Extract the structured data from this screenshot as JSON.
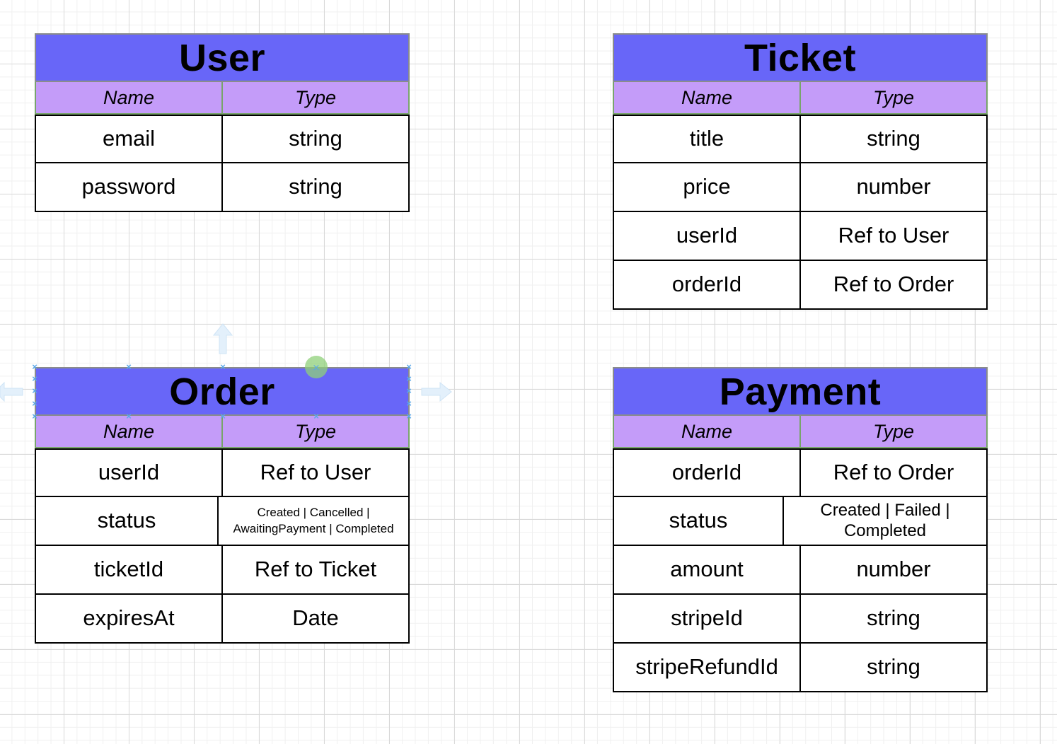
{
  "entities": {
    "user": {
      "title": "User",
      "header": {
        "name": "Name",
        "type": "Type"
      },
      "rows": [
        {
          "name": "email",
          "type": "string"
        },
        {
          "name": "password",
          "type": "string"
        }
      ]
    },
    "ticket": {
      "title": "Ticket",
      "header": {
        "name": "Name",
        "type": "Type"
      },
      "rows": [
        {
          "name": "title",
          "type": "string"
        },
        {
          "name": "price",
          "type": "number"
        },
        {
          "name": "userId",
          "type": "Ref to User"
        },
        {
          "name": "orderId",
          "type": "Ref to Order"
        }
      ]
    },
    "order": {
      "title": "Order",
      "header": {
        "name": "Name",
        "type": "Type"
      },
      "rows": [
        {
          "name": "userId",
          "type": "Ref to User"
        },
        {
          "name": "status",
          "type": "Created | Cancelled | AwaitingPayment | Completed"
        },
        {
          "name": "ticketId",
          "type": "Ref to Ticket"
        },
        {
          "name": "expiresAt",
          "type": "Date"
        }
      ]
    },
    "payment": {
      "title": "Payment",
      "header": {
        "name": "Name",
        "type": "Type"
      },
      "rows": [
        {
          "name": "orderId",
          "type": "Ref to Order"
        },
        {
          "name": "status",
          "type": "Created | Failed | Completed"
        },
        {
          "name": "amount",
          "type": "number"
        },
        {
          "name": "stripeId",
          "type": "string"
        },
        {
          "name": "stripeRefundId",
          "type": "string"
        }
      ]
    }
  },
  "colors": {
    "title_fill": "#6866f8",
    "header_fill": "#c49cf9",
    "selection": "#5aa8e8",
    "rotate_handle": "#8fd07a"
  },
  "icons": [
    "connect-arrow-icon",
    "rotate-handle-icon",
    "resize-handle-icon"
  ]
}
